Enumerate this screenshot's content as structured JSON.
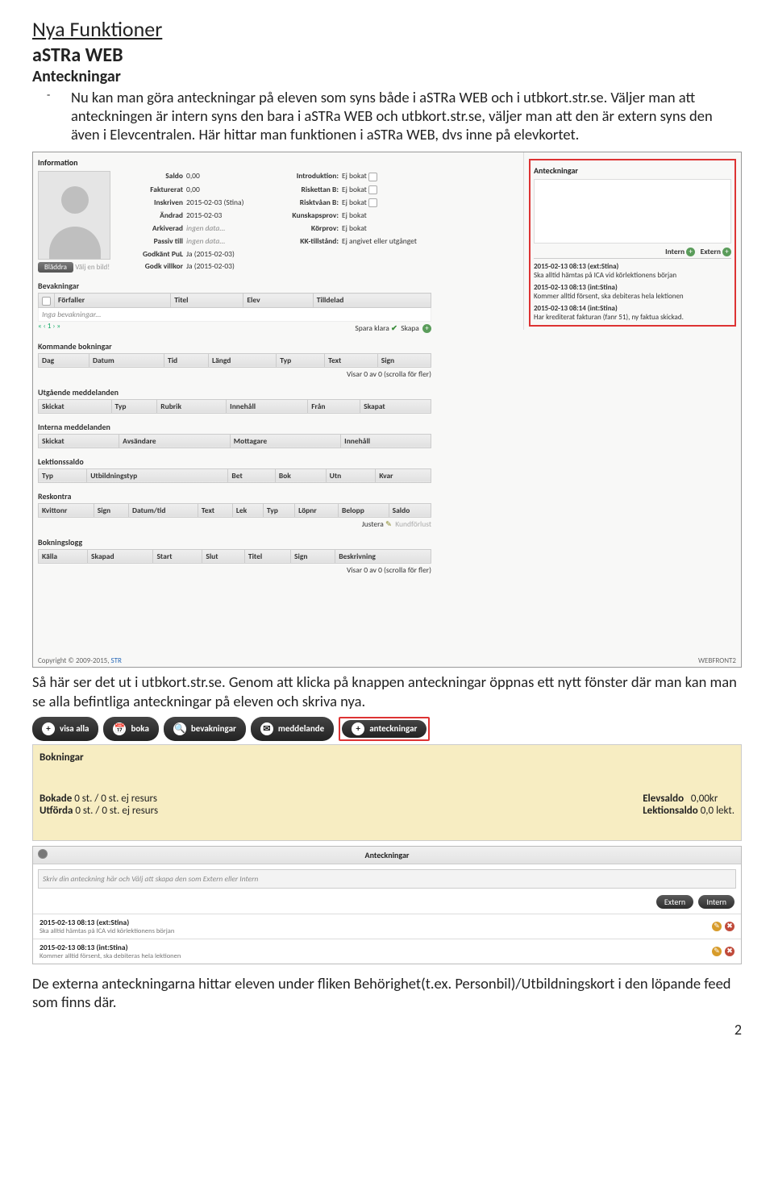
{
  "doc": {
    "title": "Nya Funktioner",
    "subtitle": "aSTRa WEB",
    "section": "Anteckningar",
    "bullet": "Nu kan man göra anteckningar på eleven som syns både i aSTRa WEB och i utbkort.str.se. Väljer man att anteckningen är intern syns den bara i aSTRa WEB och utbkort.str.se, väljer man att den är extern syns den även i Elevcentralen. Här hittar man funktionen i aSTRa WEB, dvs inne på elevkortet.",
    "mid_para": "Så här ser det ut i utbkort.str.se. Genom att klicka på knappen anteckningar öppnas ett nytt fönster där man kan man se alla befintliga anteckningar på eleven och skriva nya.",
    "bottom_para": "De externa anteckningarna hittar eleven under fliken Behörighet(t.ex. Personbil)/Utbildningskort i den löpande feed som finns där.",
    "page": "2"
  },
  "s1": {
    "info_title": "Information",
    "saldo_l": "Saldo",
    "saldo_v": "0,00",
    "fakt_l": "Fakturerat",
    "fakt_v": "0,00",
    "insk_l": "Inskriven",
    "insk_v": "2015-02-03 (Stina)",
    "andr_l": "Ändrad",
    "andr_v": "2015-02-03",
    "ark_l": "Arkiverad",
    "ark_v": "ingen data...",
    "pas_l": "Passiv till",
    "pas_v": "ingen data...",
    "pul_l": "Godkänt PuL",
    "pul_v": "Ja (2015-02-03)",
    "vil_l": "Godk villkor",
    "vil_v": "Ja (2015-02-03)",
    "intro_l": "Introduktion:",
    "intro_v": "Ej bokat",
    "r1_l": "Riskettan B:",
    "r1_v": "Ej bokat",
    "r2_l": "Risktvåan B:",
    "r2_v": "Ej bokat",
    "kun_l": "Kunskapsprov:",
    "kun_v": "Ej bokat",
    "kor_l": "Körprov:",
    "kor_v": "Ej bokat",
    "kk_l": "KK-tillstånd:",
    "kk_v": "Ej angivet eller utgånget",
    "browse": "Bläddra",
    "browse2": "Välj en bild!",
    "bev": "Bevakningar",
    "bev_h1": "Förfaller",
    "bev_h2": "Titel",
    "bev_h3": "Elev",
    "bev_h4": "Tilldelad",
    "bev_empty": "Inga bevakningar...",
    "pager": "« ‹ 1 › »",
    "spara": "Spara klara",
    "skapa": "Skapa",
    "kom": "Kommande bokningar",
    "kom_h1": "Dag",
    "kom_h2": "Datum",
    "kom_h3": "Tid",
    "kom_h4": "Längd",
    "kom_h5": "Typ",
    "kom_h6": "Text",
    "kom_h7": "Sign",
    "kom_foot": "Visar 0 av 0 (scrolla för fler)",
    "utg": "Utgående meddelanden",
    "utg_h1": "Skickat",
    "utg_h2": "Typ",
    "utg_h3": "Rubrik",
    "utg_h4": "Innehåll",
    "utg_h5": "Från",
    "utg_h6": "Skapat",
    "int": "Interna meddelanden",
    "int_h1": "Skickat",
    "int_h2": "Avsändare",
    "int_h3": "Mottagare",
    "int_h4": "Innehåll",
    "lek": "Lektionssaldo",
    "lek_h1": "Typ",
    "lek_h2": "Utbildningstyp",
    "lek_h3": "Bet",
    "lek_h4": "Bok",
    "lek_h5": "Utn",
    "lek_h6": "Kvar",
    "res": "Reskontra",
    "res_h1": "Kvittonr",
    "res_h2": "Sign",
    "res_h3": "Datum/tid",
    "res_h4": "Text",
    "res_h5": "Lek",
    "res_h6": "Typ",
    "res_h7": "Löpnr",
    "res_h8": "Belopp",
    "res_h9": "Saldo",
    "res_j": "Justera",
    "res_k": "Kundförlust",
    "bok": "Bokningslogg",
    "bok_h1": "Källa",
    "bok_h2": "Skapad",
    "bok_h3": "Start",
    "bok_h4": "Slut",
    "bok_h5": "Titel",
    "bok_h6": "Sign",
    "bok_h7": "Beskrivning",
    "bok_foot": "Visar 0 av 0 (scrolla för fler)",
    "ann_title": "Anteckningar",
    "ann_intern": "Intern",
    "ann_extern": "Extern",
    "a1_m": "2015-02-13 08:13 (ext:Stina)",
    "a1_t": "Ska alltid hämtas på ICA vid körlektionens början",
    "a2_m": "2015-02-13 08:13 (int:Stina)",
    "a2_t": "Kommer alltid försent, ska debiteras hela lektionen",
    "a3_m": "2015-02-13 08:14 (int:Stina)",
    "a3_t": "Har krediterat fakturan (fanr 51), ny faktua skickad.",
    "copy": "Copyright © 2009-2015, ",
    "copy2": "STR",
    "webf": "WEBFRONT2"
  },
  "s2": {
    "b1": "visa alla",
    "b2": "boka",
    "b3": "bevakningar",
    "b4": "meddelande",
    "b5": "anteckningar",
    "ytitle": "Bokningar",
    "l1a": "Bokade",
    "l1b": "0 st. / 0 st. ej resurs",
    "l2a": "Utförda",
    "l2b": "0 st. / 0 st. ej resurs",
    "r1a": "Elevsaldo",
    "r1b": "0,00kr",
    "r2a": "Lektionsaldo",
    "r2b": "0,0 lekt.",
    "dlg": "Anteckningar",
    "ph": "Skriv din anteckning här och Välj att skapa den som Extern eller Intern",
    "ex": "Extern",
    "in": "Intern",
    "d1m": "2015-02-13 08:13 (ext:Stina)",
    "d1t": "Ska alltid hämtas på ICA vid körlektionens början",
    "d2m": "2015-02-13 08:13 (int:Stina)",
    "d2t": "Kommer alltid försent, ska debiteras hela lektionen"
  }
}
